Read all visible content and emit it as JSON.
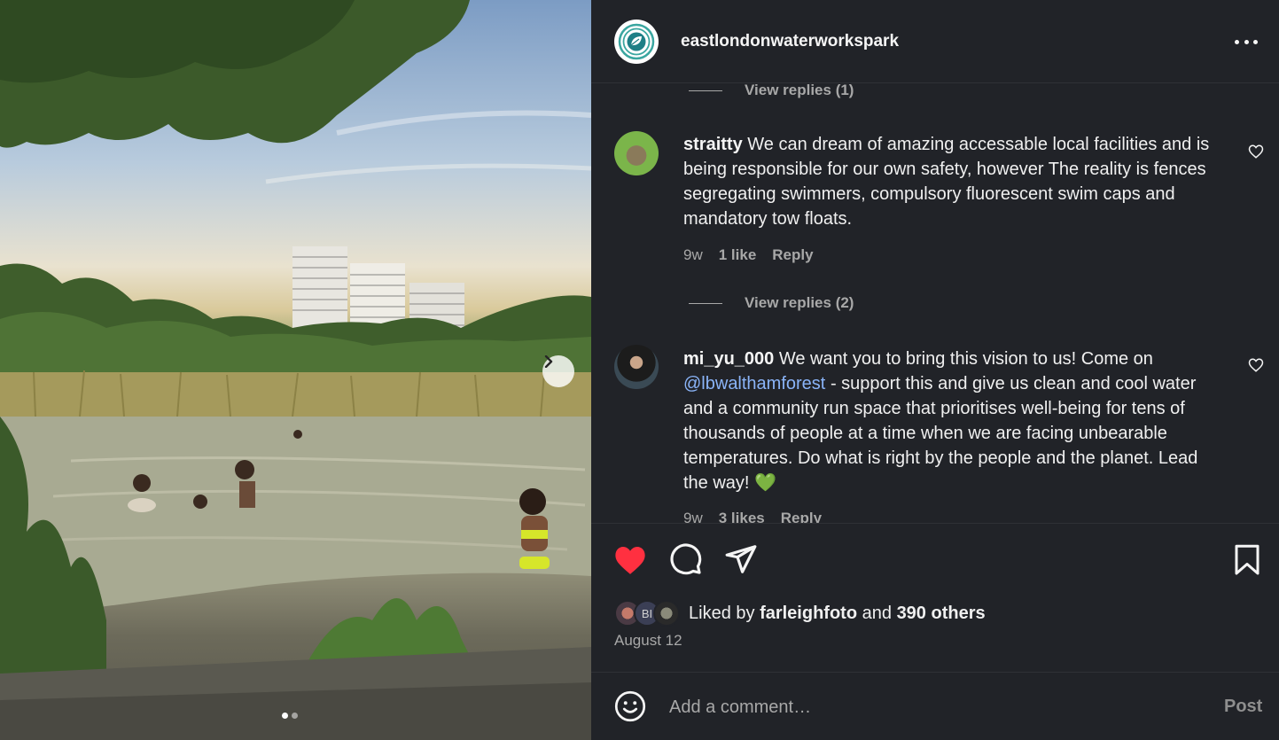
{
  "post": {
    "username": "eastlondonwaterworkspark",
    "carousel_dots": [
      true,
      false
    ]
  },
  "comments": {
    "view_replies_1": "View replies (1)",
    "view_replies_2": "View replies (2)",
    "items": [
      {
        "username": "straitty",
        "text": "We can dream of amazing accessable local facilities and is being responsible for our own safety, however The reality is fences segregating swimmers, compulsory fluorescent swim caps and mandatory tow floats.",
        "time": "9w",
        "likes": "1 like",
        "reply": "Reply"
      },
      {
        "username": "mi_yu_000",
        "text_before": "We want you to bring this vision to us! Come on",
        "mention": "@lbwalthamforest",
        "text_after": "- support this and give us clean and cool water and a community run space that prioritises well-being for tens of thousands of people at a time when we are facing unbearable temperatures. Do what is right by the people and the planet. Lead the way!",
        "emoji": "💚",
        "time": "9w",
        "likes": "3 likes",
        "reply": "Reply"
      }
    ]
  },
  "actions": {
    "liked_by_prefix": "Liked by",
    "liked_by_user": "farleighfoto",
    "liked_by_and": "and",
    "liked_by_others": "390 others",
    "mini_avatar_label": "BI",
    "date": "August 12",
    "like_active": true,
    "like_color": "#ff3040"
  },
  "composer": {
    "placeholder": "Add a comment…",
    "post_label": "Post"
  },
  "colors": {
    "panel_bg": "#212328",
    "mention": "#8ab4f8",
    "muted": "#a8a8a8"
  }
}
